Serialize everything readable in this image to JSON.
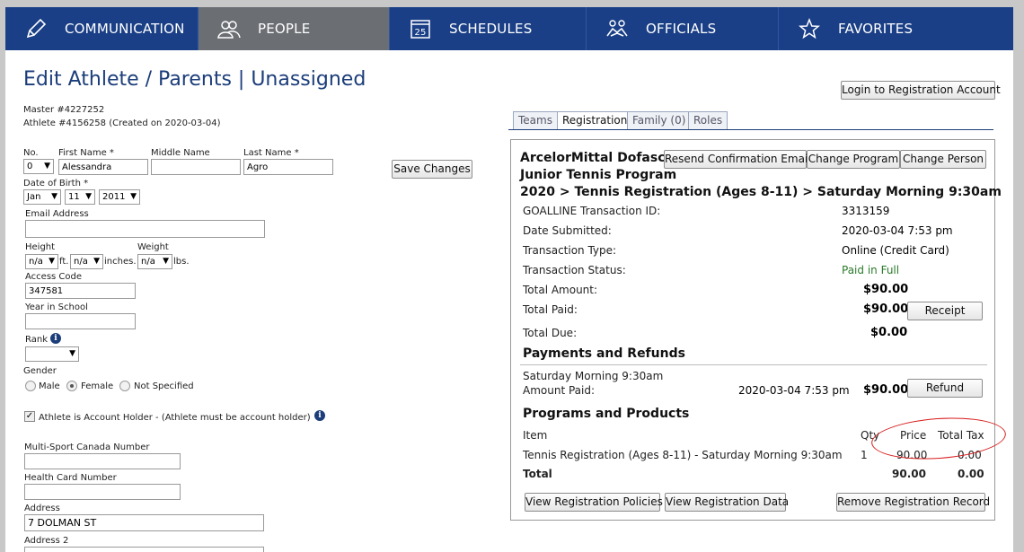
{
  "nav": {
    "items": [
      {
        "label": "COMMUNICATION",
        "icon": "pencil-icon"
      },
      {
        "label": "PEOPLE",
        "icon": "people-icon"
      },
      {
        "label": "SCHEDULES",
        "icon": "calendar-icon",
        "badge": "25"
      },
      {
        "label": "OFFICIALS",
        "icon": "handshake-icon"
      },
      {
        "label": "FAVORITES",
        "icon": "star-icon"
      }
    ]
  },
  "page": {
    "title": "Edit Athlete / Parents | Unassigned",
    "login_button": "Login to Registration Account",
    "master": "Master #4227252",
    "athlete": "Athlete #4156258 (Created on 2020-03-04)"
  },
  "form": {
    "no_label": "No.",
    "first_label": "First Name *",
    "middle_label": "Middle Name",
    "last_label": "Last Name *",
    "no_value": "0",
    "first_value": "Alessandra",
    "middle_value": "",
    "last_value": "Agro",
    "save_button": "Save Changes",
    "dob_label": "Date of Birth *",
    "dob_month": "Jan",
    "dob_day": "11",
    "dob_year": "2011",
    "email_label": "Email Address",
    "email_value": "",
    "height_label": "Height",
    "weight_label": "Weight",
    "height_ft": "n/a",
    "ft_label": "ft.",
    "height_in": "n/a",
    "inches_label": "inches.",
    "weight_val": "n/a",
    "lbs_label": "lbs.",
    "access_label": "Access Code",
    "access_value": "347581",
    "year_label": "Year in School",
    "year_value": "",
    "rank_label": "Rank",
    "rank_value": "",
    "gender_label": "Gender",
    "gender_male": "Male",
    "gender_female": "Female",
    "gender_ns": "Not Specified",
    "account_holder": "Athlete is Account Holder - (Athlete must be account holder)",
    "msc_label": "Multi-Sport Canada Number",
    "msc_value": "",
    "health_label": "Health Card Number",
    "health_value": "",
    "address_label": "Address",
    "address_value": "7 DOLMAN ST",
    "address2_label": "Address 2"
  },
  "tabs": [
    "Teams",
    "Registration",
    "Family (0)",
    "Roles"
  ],
  "registration": {
    "org_line1": "ArcelorMittal Dofasco",
    "org_line2": "Junior Tennis Program",
    "program": "2020 > Tennis Registration (Ages 8-11) > Saturday Morning 9:30am",
    "resend_button": "Resend Confirmation Email",
    "change_program_button": "Change Program",
    "change_person_button": "Change Person",
    "rows": [
      {
        "label": "GOALLINE Transaction ID:",
        "value": "3313159"
      },
      {
        "label": "Date Submitted:",
        "value": "2020-03-04 7:53 pm"
      },
      {
        "label": "Transaction Type:",
        "value": "Online (Credit Card)"
      },
      {
        "label": "Transaction Status:",
        "value": "Paid in Full"
      }
    ],
    "total_amount_label": "Total Amount:",
    "total_amount": "$90.00",
    "total_paid_label": "Total Paid:",
    "total_paid": "$90.00",
    "receipt_button": "Receipt",
    "total_due_label": "Total Due:",
    "total_due": "$0.00",
    "payments_heading": "Payments and Refunds",
    "payment_desc": "Saturday Morning 9:30am",
    "amount_paid_label": "Amount Paid:",
    "payment_date": "2020-03-04 7:53 pm",
    "payment_amount": "$90.00",
    "refund_button": "Refund",
    "products_heading": "Programs and Products",
    "col_item": "Item",
    "col_qty": "Qty",
    "col_price": "Price",
    "col_tax": "Total Tax",
    "item_name": "Tennis Registration (Ages 8-11) - Saturday Morning 9:30am",
    "item_qty": "1",
    "item_price": "90.00",
    "item_tax": "0.00",
    "total_label": "Total",
    "total_price": "90.00",
    "total_tax": "0.00",
    "policies_button": "View Registration Policies",
    "data_button": "View Registration Data",
    "remove_button": "Remove Registration Record"
  },
  "colors": {
    "nav": "#1a3f86",
    "nav_active": "#6b6e73",
    "title": "#1b3d7a",
    "paid": "#2a7a2a",
    "annotation": "#d81b1b"
  }
}
